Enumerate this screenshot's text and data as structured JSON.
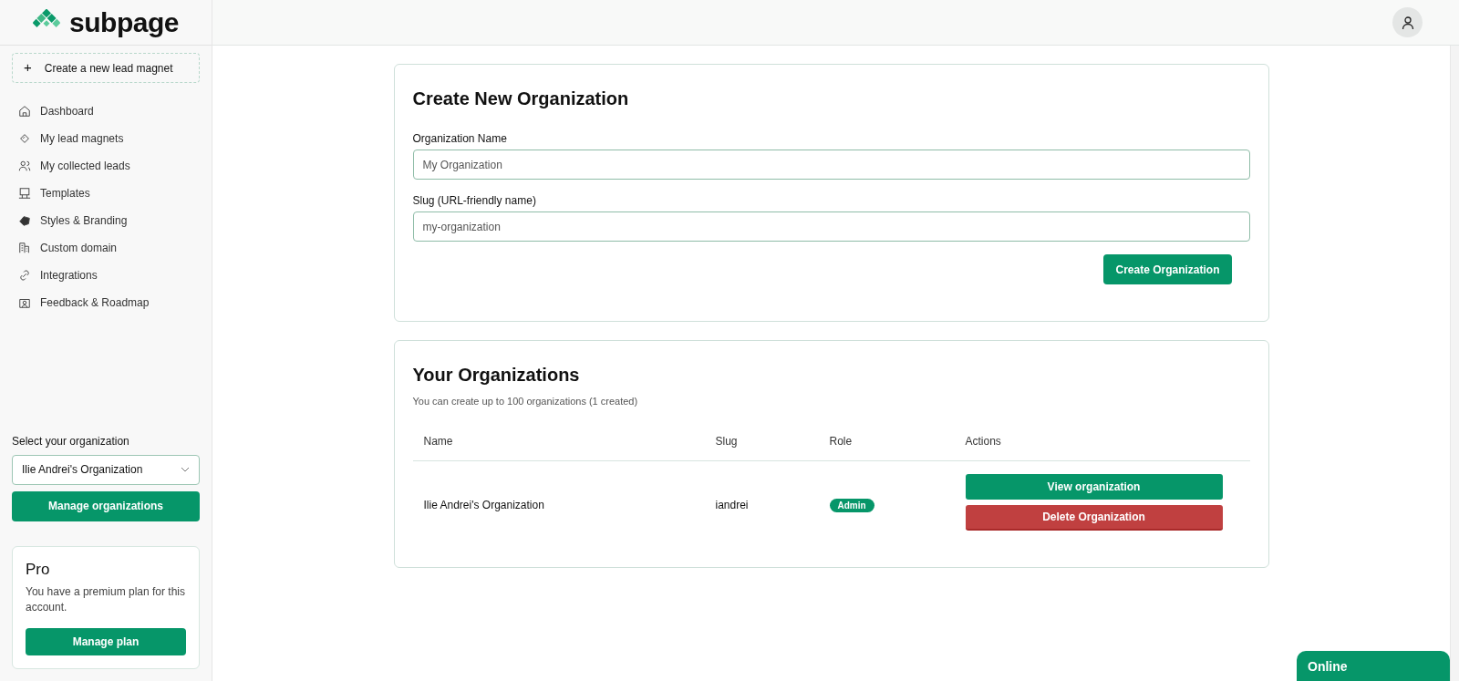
{
  "sidebar": {
    "logo_text": "subpage",
    "create_button": {
      "icon_text": "+",
      "label": "Create a new lead magnet"
    },
    "items": [
      {
        "label": "Dashboard"
      },
      {
        "label": "My lead magnets"
      },
      {
        "label": "My collected leads"
      },
      {
        "label": "Templates"
      },
      {
        "label": "Styles & Branding"
      },
      {
        "label": "Custom domain"
      },
      {
        "label": "Integrations"
      },
      {
        "label": "Feedback & Roadmap"
      }
    ],
    "organization_select": {
      "label": "Select your organization",
      "value": "Ilie Andrei's Organization"
    },
    "manage_organizations_button": "Manage organizations",
    "plan_card": {
      "title": "Pro",
      "text": "You have a premium plan for this account.",
      "button": "Manage plan"
    }
  },
  "create_form": {
    "title": "Create New Organization",
    "fields": [
      {
        "label": "Organization Name",
        "placeholder": "My Organization"
      },
      {
        "label": "Slug (URL-friendly name)",
        "placeholder": "my-organization"
      }
    ],
    "submit": "Create Organization"
  },
  "organizations": {
    "title": "Your Organizations",
    "subtitle": "You can create up to 100 organizations (1 created)",
    "columns": [
      "Name",
      "Slug",
      "Role",
      "Actions"
    ],
    "rows": [
      {
        "name": "Ilie Andrei's Organization",
        "slug": "iandrei",
        "role": "Admin",
        "actions": [
          {
            "kind": "view",
            "label": "View organization"
          },
          {
            "kind": "delete",
            "label": "Delete Organization"
          }
        ]
      }
    ]
  },
  "chat_tab": "Online"
}
